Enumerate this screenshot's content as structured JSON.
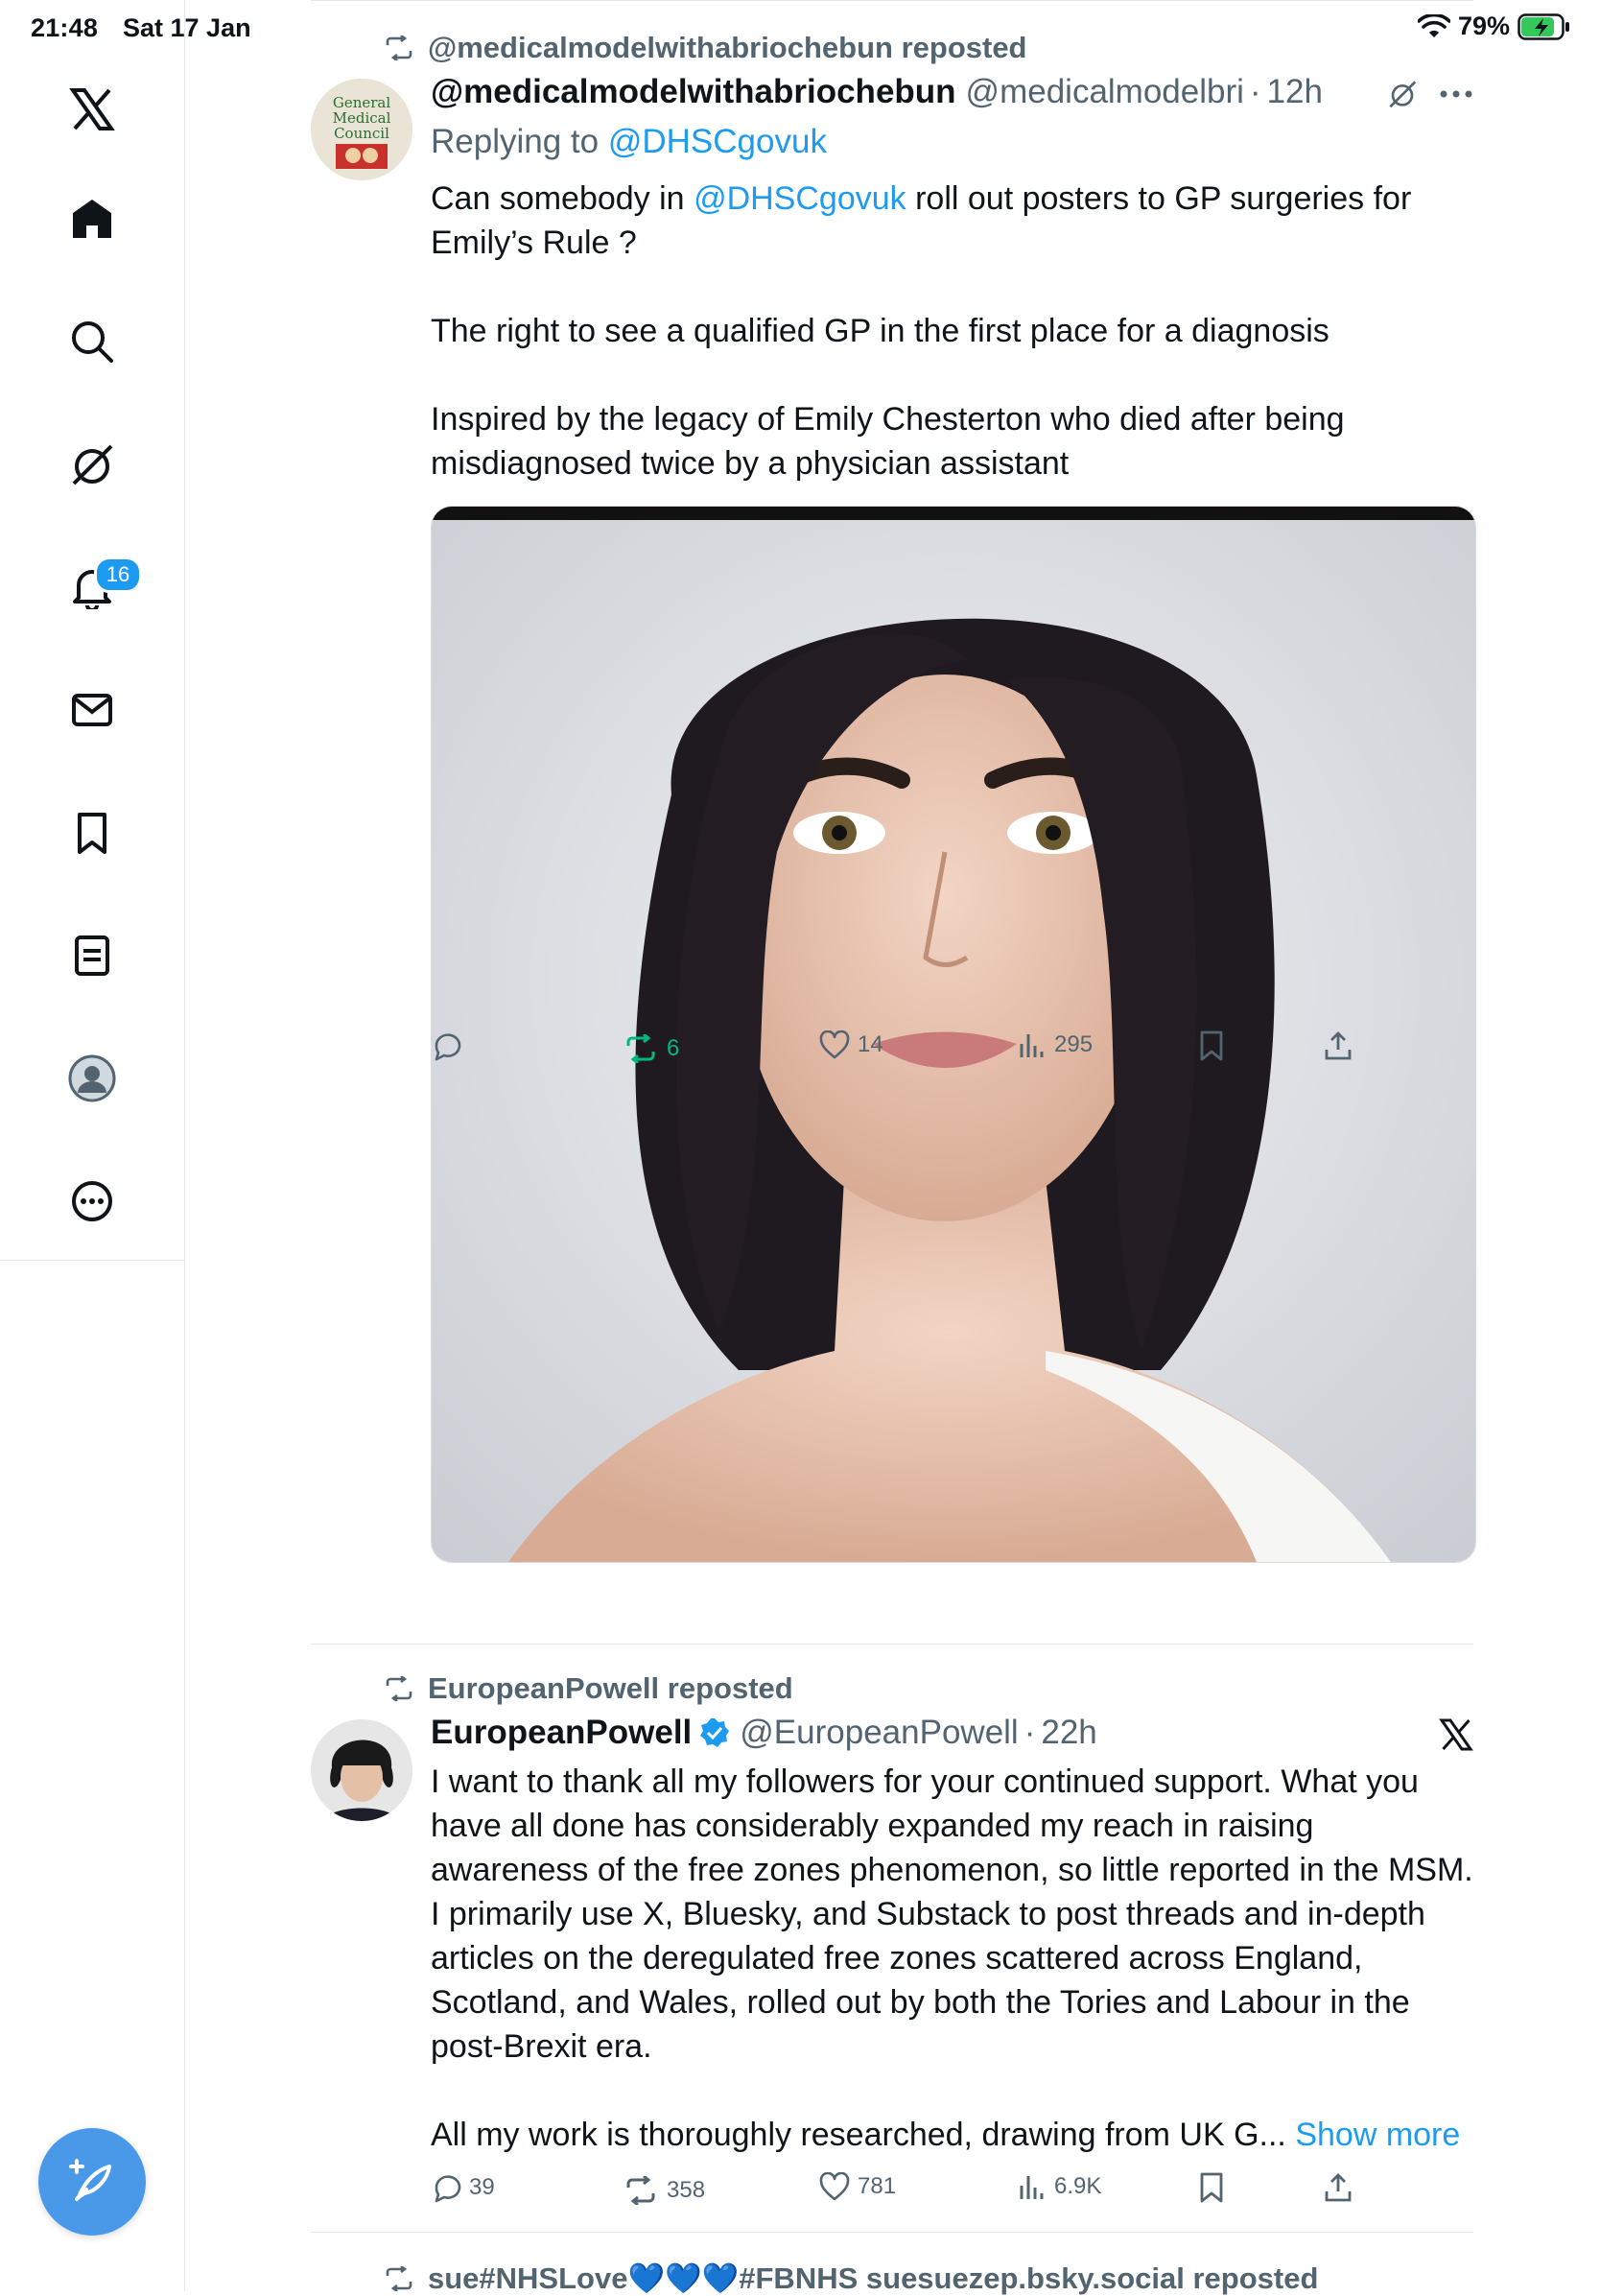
{
  "status": {
    "time": "21:48",
    "date": "Sat 17 Jan",
    "battery": "79%"
  },
  "sidebar": {
    "items": [
      {
        "name": "x-logo"
      },
      {
        "name": "home"
      },
      {
        "name": "search"
      },
      {
        "name": "grok"
      },
      {
        "name": "notifications",
        "badge": "16"
      },
      {
        "name": "messages"
      },
      {
        "name": "bookmarks"
      },
      {
        "name": "lists"
      },
      {
        "name": "profile"
      },
      {
        "name": "more"
      }
    ],
    "compose": "compose"
  },
  "tweets": [
    {
      "repost_by": "@medicalmodelwithabriochebun reposted",
      "name": "@medicalmodelwithabriochebun",
      "handle": "@medicalmodelbri",
      "time": "12h",
      "replying_prefix": "Replying to",
      "replying_to": "@DHSCgovuk",
      "text_pre": "Can somebody in",
      "text_mention": "@DHSCgovuk",
      "text_post": "roll out  posters to GP surgeries for Emily’s Rule ?",
      "text_p2": "The right to see a qualified GP in the first place for a diagnosis",
      "text_p3": "Inspired by the legacy of Emily Chesterton who died after being misdiagnosed twice by a physician assistant",
      "stats": {
        "replies": "",
        "reposts": "6",
        "likes": "14",
        "views": "295"
      }
    },
    {
      "repost_by": "EuropeanPowell reposted",
      "name": "EuropeanPowell",
      "handle": "@EuropeanPowell",
      "time": "22h",
      "text_p1": "I want to thank all my followers for your continued support. What you have all done has considerably expanded my reach in raising awareness of the free zones phenomenon, so little reported in the MSM.",
      "text_p2": "I primarily use X, Bluesky, and Substack to post threads and in-depth articles on the deregulated free zones scattered across England, Scotland, and Wales, rolled out by both the Tories and Labour in the post-Brexit era.",
      "text_p3": "All my work is thoroughly researched, drawing from UK G...",
      "show_more": "Show more",
      "stats": {
        "replies": "39",
        "reposts": "358",
        "likes": "781",
        "views": "6.9K"
      }
    },
    {
      "repost_by": "sue#NHSLove💙💙💙#FBNHS suesuezep.bsky.social reposted"
    }
  ],
  "colors": {
    "accent": "#1d9bf0",
    "repost_green": "#00ba7c",
    "muted": "#536471"
  }
}
